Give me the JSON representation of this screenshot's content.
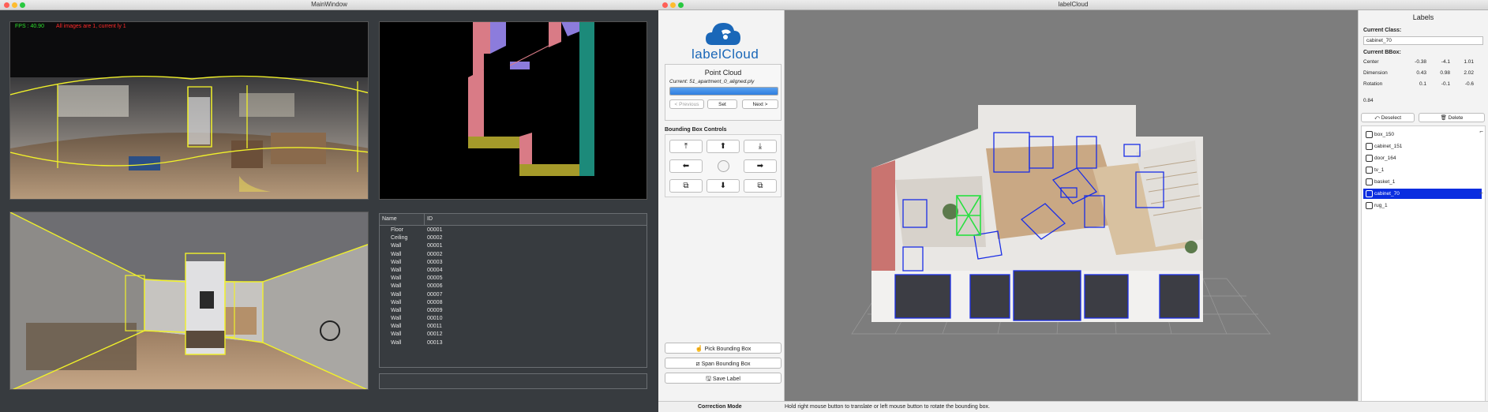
{
  "main_window": {
    "title": "MainWindow",
    "fps_text": "FPS : 40.90",
    "warning_text": "All images are 1, current ly 1",
    "table": {
      "headers": [
        "Name",
        "ID"
      ],
      "rows": [
        [
          "Floor",
          "00001"
        ],
        [
          "Ceiling",
          "00002"
        ],
        [
          "Wall",
          "00001"
        ],
        [
          "Wall",
          "00002"
        ],
        [
          "Wall",
          "00003"
        ],
        [
          "Wall",
          "00004"
        ],
        [
          "Wall",
          "00005"
        ],
        [
          "Wall",
          "00006"
        ],
        [
          "Wall",
          "00007"
        ],
        [
          "Wall",
          "00008"
        ],
        [
          "Wall",
          "00009"
        ],
        [
          "Wall",
          "00010"
        ],
        [
          "Wall",
          "00011"
        ],
        [
          "Wall",
          "00012"
        ],
        [
          "Wall",
          "00013"
        ]
      ]
    }
  },
  "labelcloud": {
    "title": "labelCloud",
    "logo_text": "labelCloud",
    "point_cloud": {
      "title": "Point Cloud",
      "current": "Current: 51_apartment_0_aligned.ply",
      "progress": 1.0,
      "prev_label": "< Previous",
      "set_label": "Set",
      "next_label": "Next >"
    },
    "bbox_controls": {
      "title": "Bounding Box Controls",
      "buttons": [
        "⤒",
        "⬆",
        "⤓",
        "⬅",
        "",
        "➡",
        "⧉",
        "⬇",
        "⧉"
      ]
    },
    "pick_label": "Pick Bounding Box",
    "span_label": "Span Bounding Box",
    "save_label": "Save Label",
    "labels_panel": {
      "title": "Labels",
      "current_class_title": "Current Class:",
      "current_class_value": "cabinet_70",
      "current_bbox_title": "Current BBox:",
      "center": {
        "label": "Center",
        "v": [
          "-0.38",
          "-4.1",
          "1.01"
        ]
      },
      "dimension": {
        "label": "Dimension",
        "v": [
          "0.43",
          "0.98",
          "2.02"
        ]
      },
      "rotation": {
        "label": "Rotation",
        "v": [
          "0.1",
          "-0.1",
          "-0.6"
        ]
      },
      "rotation_extra": "0.84",
      "deselect_label": "Deselect",
      "delete_label": "Delete",
      "items": [
        "box_150",
        "cabinet_151",
        "door_164",
        "tv_1",
        "basket_1",
        "cabinet_70",
        "rug_1"
      ],
      "selected_index": 5
    },
    "status": {
      "mode": "Correction Mode",
      "message": "Hold right mouse button to translate or left mouse button to rotate the bounding box."
    }
  },
  "colors": {
    "accent_blue": "#2f7fe0",
    "selection_blue": "#0a2de0",
    "layout_yellow": "#f1f12a",
    "fps_green": "#2ee02e",
    "warning_red": "#ff2a2a"
  }
}
